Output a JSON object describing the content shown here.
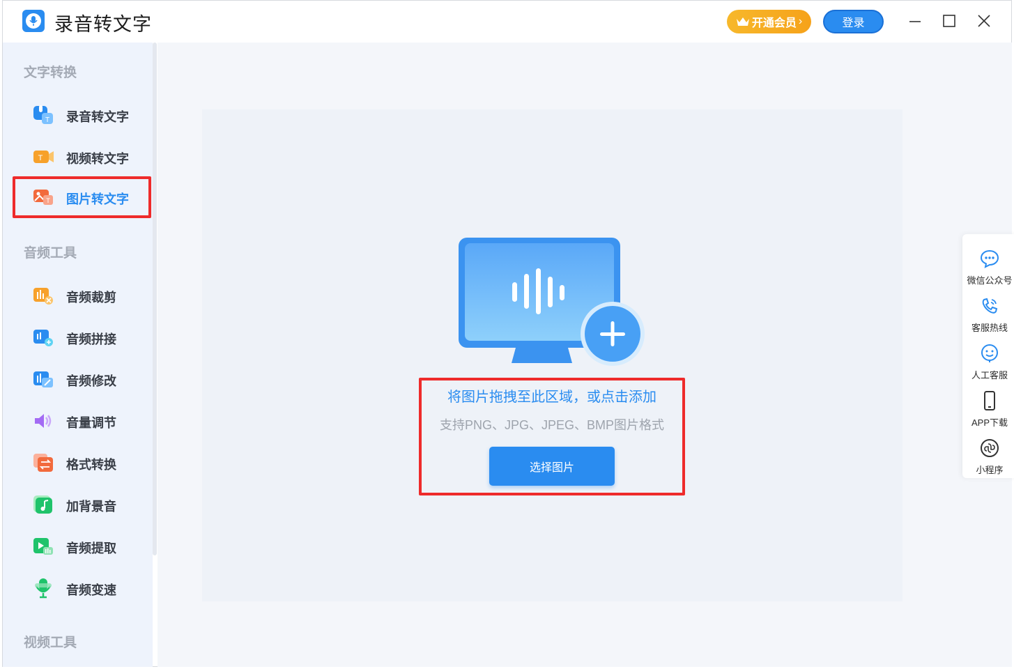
{
  "app": {
    "title": "录音转文字"
  },
  "header": {
    "vip_label": "开通会员",
    "login_label": "登录"
  },
  "sidebar": {
    "sections": [
      {
        "title": "文字转换"
      },
      {
        "title": "音频工具"
      },
      {
        "title": "视频工具"
      }
    ],
    "items": [
      {
        "label": "录音转文字",
        "icon": "record-to-text-icon"
      },
      {
        "label": "视频转文字",
        "icon": "video-to-text-icon"
      },
      {
        "label": "图片转文字",
        "icon": "image-to-text-icon",
        "active": true
      },
      {
        "label": "音频裁剪",
        "icon": "audio-cut-icon"
      },
      {
        "label": "音频拼接",
        "icon": "audio-join-icon"
      },
      {
        "label": "音频修改",
        "icon": "audio-edit-icon"
      },
      {
        "label": "音量调节",
        "icon": "volume-icon"
      },
      {
        "label": "格式转换",
        "icon": "format-convert-icon"
      },
      {
        "label": "加背景音",
        "icon": "background-music-icon"
      },
      {
        "label": "音频提取",
        "icon": "audio-extract-icon"
      },
      {
        "label": "音频变速",
        "icon": "audio-speed-icon"
      }
    ]
  },
  "main": {
    "drop_text": "将图片拖拽至此区域，或点击添加",
    "format_hint": "支持PNG、JPG、JPEG、BMP图片格式",
    "choose_label": "选择图片"
  },
  "float_bar": {
    "items": [
      {
        "label": "微信公众号",
        "icon": "wechat-icon"
      },
      {
        "label": "客服热线",
        "icon": "hotline-icon"
      },
      {
        "label": "人工客服",
        "icon": "agent-icon"
      },
      {
        "label": "APP下载",
        "icon": "phone-icon"
      },
      {
        "label": "小程序",
        "icon": "mini-program-icon"
      }
    ]
  },
  "colors": {
    "accent": "#2a8cf0",
    "highlight": "#ee2b2b",
    "vip": "#f6a21a"
  }
}
